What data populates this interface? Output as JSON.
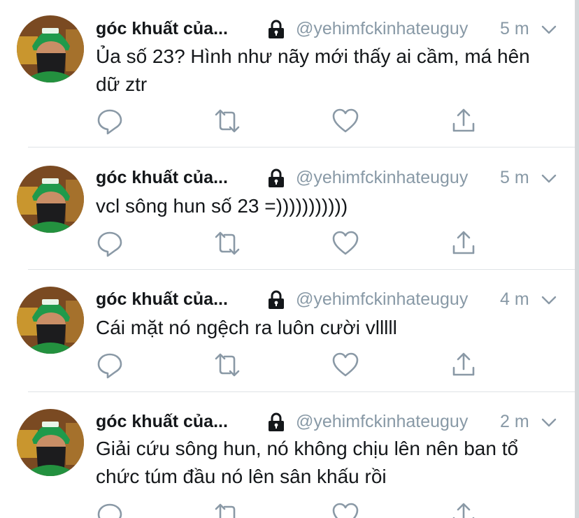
{
  "tweets": [
    {
      "author_name": "góc khuất của...",
      "handle": "@yehimfckinhateuguy",
      "time": "5 m",
      "text": "Ủa số 23? Hình như nãy mới thấy ai cầm, má hên dữ ztr"
    },
    {
      "author_name": "góc khuất của...",
      "handle": "@yehimfckinhateuguy",
      "time": "5 m",
      "text": "vcl sông hun số 23 =)))))))))))"
    },
    {
      "author_name": "góc khuất của...",
      "handle": "@yehimfckinhateuguy",
      "time": "4 m",
      "text": "Cái mặt nó ngệch ra luôn cười vlllll"
    },
    {
      "author_name": "góc khuất của...",
      "handle": "@yehimfckinhateuguy",
      "time": "2 m",
      "text": "Giải cứu sông hun, nó không chịu lên nên ban tổ chức túm đầu nó lên sân khấu rồi"
    }
  ],
  "icons": {
    "lock": "lock-icon",
    "caret": "chevron-down-icon",
    "reply": "reply-icon",
    "retweet": "retweet-icon",
    "like": "heart-icon",
    "share": "share-icon"
  },
  "colors": {
    "text": "#14171a",
    "secondary": "#8899a6",
    "icon": "#8a99a6",
    "divider": "#dfe3e6",
    "avatar_green": "#1f9a4b"
  }
}
